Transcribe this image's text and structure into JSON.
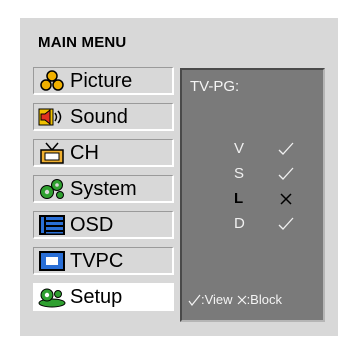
{
  "menu": {
    "title": "MAIN MENU",
    "items": [
      {
        "label": "Picture",
        "icon": "picture-icon"
      },
      {
        "label": "Sound",
        "icon": "speaker-icon"
      },
      {
        "label": "CH",
        "icon": "tv-antenna-icon"
      },
      {
        "label": "System",
        "icon": "gears-icon"
      },
      {
        "label": "OSD",
        "icon": "osd-list-icon"
      },
      {
        "label": "TVPC",
        "icon": "monitor-icon"
      },
      {
        "label": "Setup",
        "icon": "setup-icon"
      }
    ],
    "selected": "Setup"
  },
  "panel": {
    "title": "TV-PG:",
    "ratings": [
      {
        "letter": "V",
        "status": "view",
        "mark": "✓"
      },
      {
        "letter": "S",
        "status": "view",
        "mark": "✓"
      },
      {
        "letter": "L",
        "status": "block",
        "mark": "×"
      },
      {
        "letter": "D",
        "status": "view",
        "mark": "✓"
      }
    ],
    "legend": {
      "view_label": ":View",
      "block_label": ":Block"
    }
  },
  "colors": {
    "background": "#d8d8d8",
    "panel": "#7a7a7a",
    "selected_item": "#ffffff",
    "picture_icon": "#e8a000",
    "monitor_icon": "#2a6fd6",
    "gears_icon": "#2fa030"
  }
}
